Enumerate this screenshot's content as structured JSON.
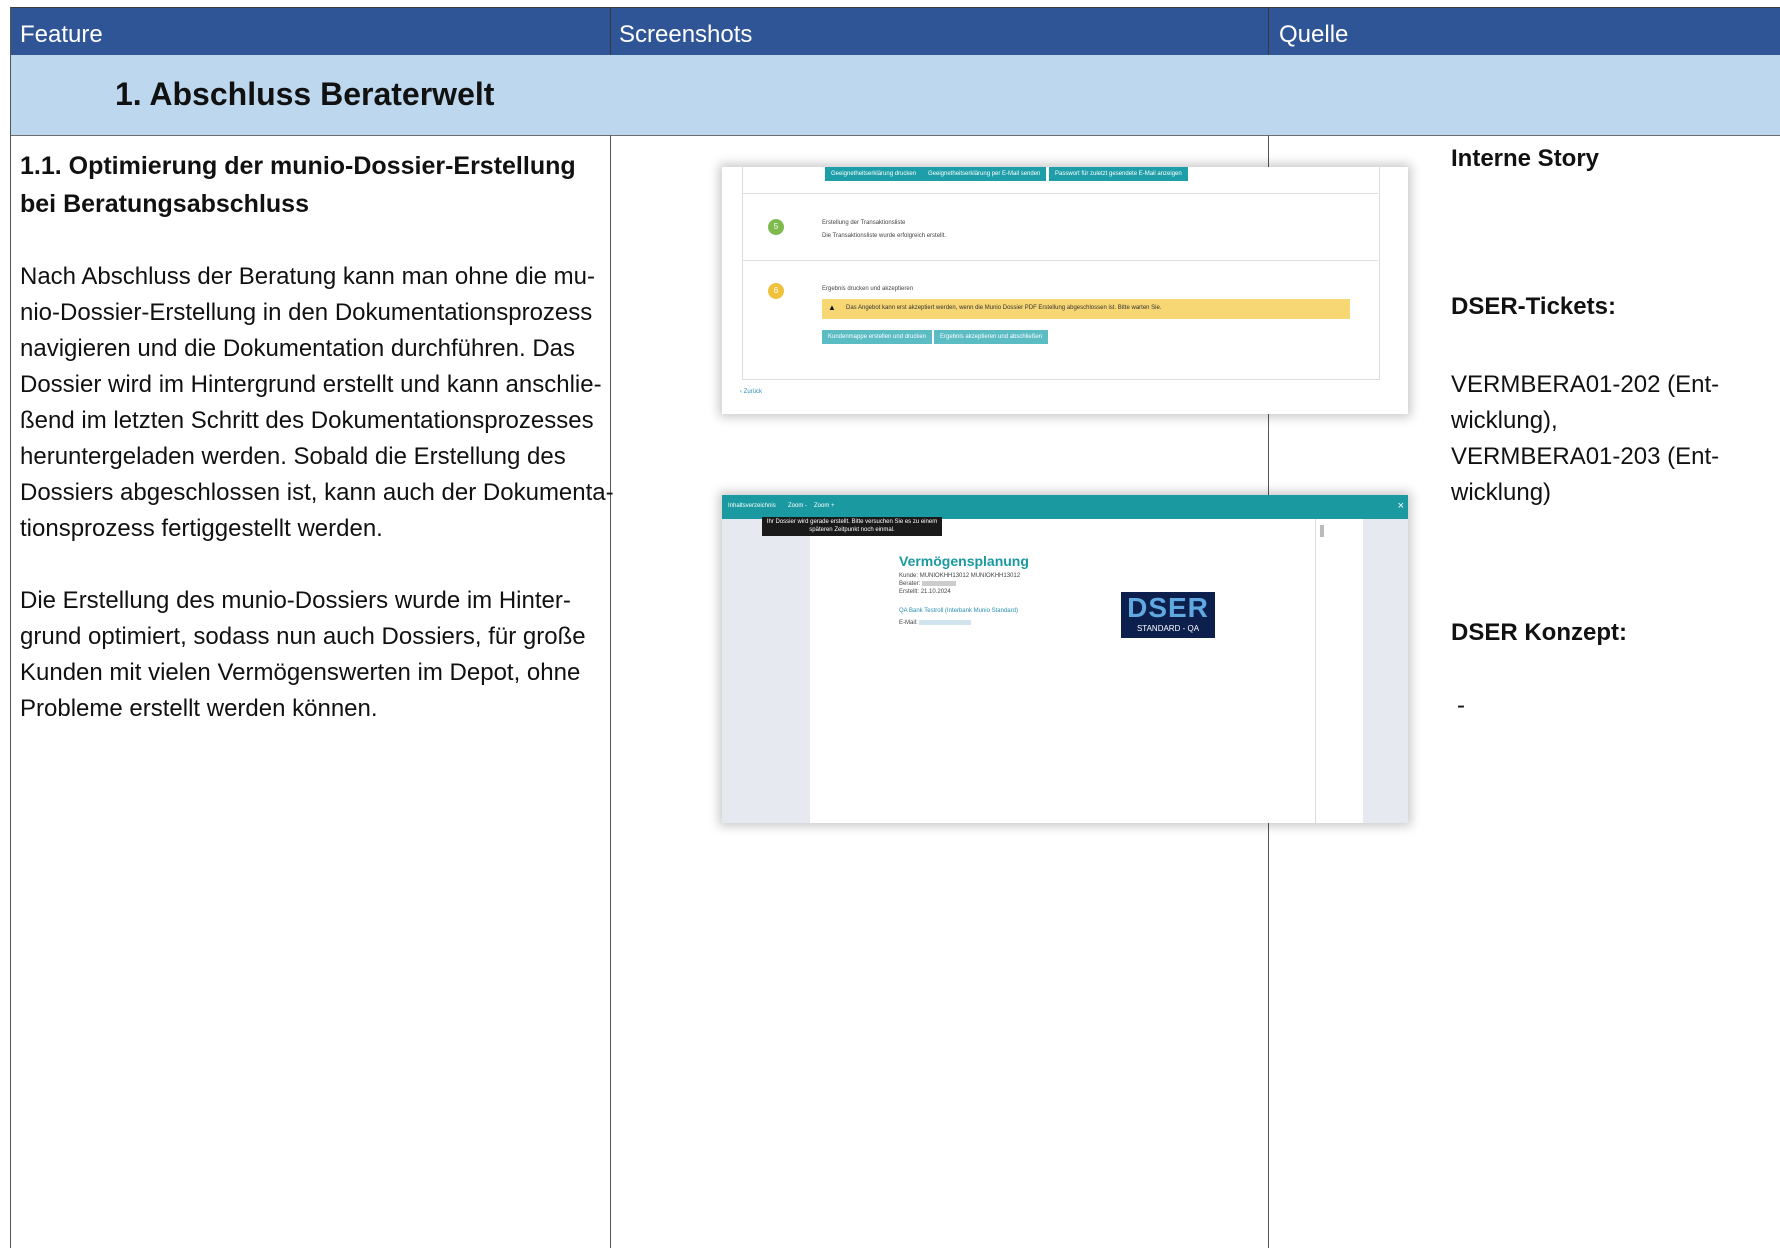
{
  "header": {
    "col1": "Feature",
    "col2": "Screenshots",
    "col3": "Quelle"
  },
  "section": {
    "title": "1. Abschluss Beraterwelt"
  },
  "feature": {
    "title_line1": "1.1. Optimierung der munio-Dossier-Erstellung",
    "title_line2": "bei Beratungsabschluss",
    "para1": [
      "Nach Abschluss der Beratung kann man ohne die mu-",
      "nio-Dossier-Erstellung in den Dokumentationsprozess",
      "navigieren und die Dokumentation durchführen. Das",
      "Dossier wird im Hintergrund erstellt und kann anschlie-",
      "ßend im letzten Schritt des Dokumentationsprozesses",
      "heruntergeladen werden. Sobald die Erstellung des",
      "Dossiers abgeschlossen ist, kann auch der Dokumenta-",
      "tionsprozess fertiggestellt werden."
    ],
    "para2": [
      "Die Erstellung des munio-Dossiers wurde im Hinter-",
      "grund optimiert, sodass nun auch Dossiers, für große",
      "Kunden mit vielen Vermögenswerten im Depot, ohne",
      "Probleme erstellt werden können."
    ]
  },
  "quelle": {
    "story_label": "Interne Story",
    "tickets_label": "DSER-Tickets:",
    "tickets": [
      "VERMBERA01-202 (Ent-",
      "wicklung),",
      "VERMBERA01-203 (Ent-",
      "wicklung)"
    ],
    "konzept_label": "DSER Konzept:",
    "konzept_value": "-"
  },
  "screenshot1": {
    "top_buttons": [
      "Geeignetheitserklärung drucken",
      "Geeignetheitserklärung per E-Mail senden",
      "Passwort für zuletzt gesendete E-Mail anzeigen"
    ],
    "step5_title": "Erstellung der Transaktionsliste",
    "step5_text": "Die Transaktionsliste wurde erfolgreich erstellt.",
    "step6_title": "Ergebnis drucken und akzeptieren",
    "warning": "Das Angebot kann erst akzeptiert werden, wenn die Munio Dossier PDF Erstellung abgeschlossen ist. Bitte warten Sie.",
    "btn_a": "Kundenmappe erstellen und drucken",
    "btn_b": "Ergebnis akzeptieren und abschließen",
    "back_link": "Zurück",
    "step5_num": "5",
    "step6_num": "6"
  },
  "screenshot2": {
    "toolbar_items": [
      "Inhaltsverzeichnis",
      "Zoom -",
      "Zoom +"
    ],
    "tooltip_line1": "Ihr Dossier wird gerade erstellt. Bitte versuchen Sie es zu einem",
    "tooltip_line2": "späteren Zeitpunkt noch einmal.",
    "doc_title": "Vermögensplanung",
    "kunde_label": "Kunde:",
    "kunde_value": "MUNIOKHH13012 MUNIOKHH13012",
    "berater_label": "Berater:",
    "erstellt_label": "Erstellt:",
    "erstellt_value": "21.10.2024",
    "bank_link": "QA Bank Testroll (Interbank Munio Standard)",
    "email_label": "E-Mail:",
    "logo_text": "DSER",
    "logo_sub": "STANDARD - QA",
    "colors": {
      "toolbar": "#1a9aa0",
      "logo_bg": "#0c1f4d",
      "logo_fg": "#5fa8e0"
    }
  }
}
